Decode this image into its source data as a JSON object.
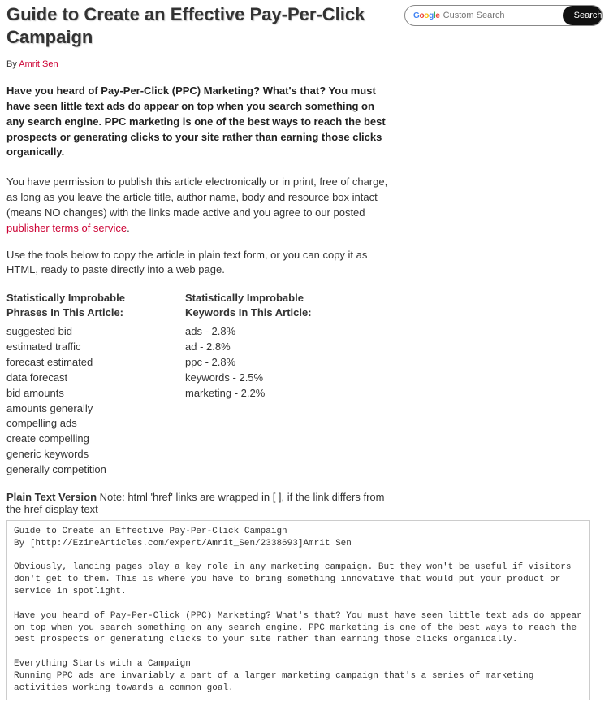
{
  "title": "Guide to Create an Effective Pay-Per-Click Campaign",
  "byline_prefix": "By ",
  "author": "Amrit Sen",
  "intro": "Have you heard of Pay-Per-Click (PPC) Marketing? What's that? You must have seen little text ads do appear on top when you search something on any search engine. PPC marketing is one of the best ways to reach the best prospects or generating clicks to your site rather than earning those clicks organically.",
  "permission_pre": "You have permission to publish this article electronically or in print, free of charge, as long as you leave the article title, author name, body and resource box intact (means NO changes) with the links made active and you agree to our posted ",
  "permission_link": "publisher terms of service",
  "permission_post": ".",
  "tools_text": "Use the tools below to copy the article in plain text form, or you can copy it as HTML, ready to paste directly into a web page.",
  "phrases_heading": "Statistically Improbable Phrases In This Article:",
  "phrases": [
    "suggested bid",
    "estimated traffic",
    "forecast estimated",
    "data forecast",
    "bid amounts",
    "amounts generally",
    "compelling ads",
    "create compelling",
    "generic keywords",
    "generally competition"
  ],
  "keywords_heading": "Statistically Improbable Keywords In This Article:",
  "keywords": [
    "ads - 2.8%",
    "ad - 2.8%",
    "ppc - 2.8%",
    "keywords - 2.5%",
    "marketing - 2.2%"
  ],
  "ptv_label_bold": "Plain Text Version",
  "ptv_label_rest": " Note: html 'href' links are wrapped in [ ], if the link differs from the href display text",
  "plain_text": "Guide to Create an Effective Pay-Per-Click Campaign\nBy [http://EzineArticles.com/expert/Amrit_Sen/2338693]Amrit Sen\n\nObviously, landing pages play a key role in any marketing campaign. But they won't be useful if visitors don't get to them. This is where you have to bring something innovative that would put your product or service in spotlight.\n\nHave you heard of Pay-Per-Click (PPC) Marketing? What's that? You must have seen little text ads do appear on top when you search something on any search engine. PPC marketing is one of the best ways to reach the best prospects or generating clicks to your site rather than earning those clicks organically.\n\nEverything Starts with a Campaign\nRunning PPC ads are invariably a part of a larger marketing campaign that's a series of marketing activities working towards a common goal.",
  "search": {
    "placeholder": "Custom Search",
    "button": "Search"
  }
}
